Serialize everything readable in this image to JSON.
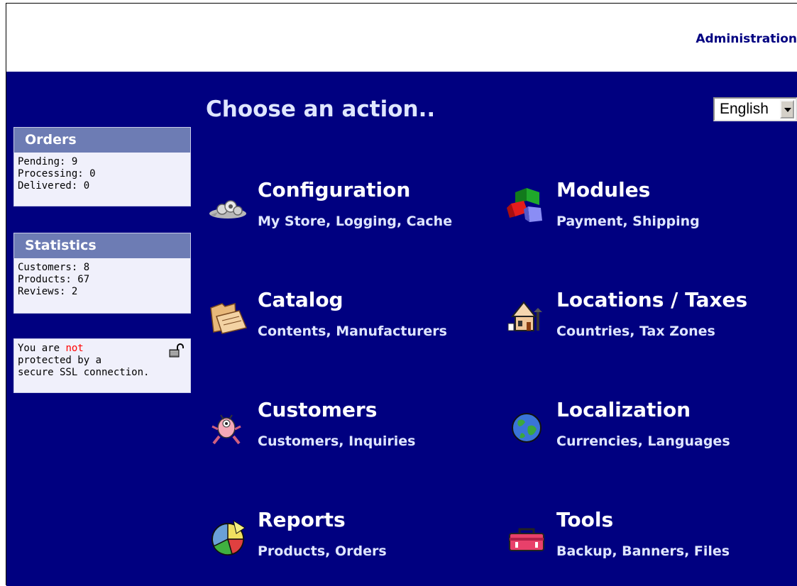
{
  "header": {
    "admin_link": "Administration"
  },
  "sidebar": {
    "orders": {
      "title": "Orders",
      "lines": [
        "Pending: 9",
        "Processing: 0",
        "Delivered: 0"
      ]
    },
    "statistics": {
      "title": "Statistics",
      "lines": [
        "Customers: 8",
        "Products: 67",
        "Reviews: 2"
      ]
    },
    "ssl": {
      "prefix": "You are ",
      "highlight": "not",
      "line2": "protected by a",
      "line3": "secure SSL connection.",
      "icon": "unlocked-padlock-icon",
      "highlight_color": "#ff0000"
    }
  },
  "main": {
    "title": "Choose an action..",
    "language": "English",
    "actions": [
      {
        "title": "Configuration",
        "subtitle": "My Store, Logging, Cache",
        "icon": "configuration-icon"
      },
      {
        "title": "Modules",
        "subtitle": "Payment, Shipping",
        "icon": "modules-cubes-icon"
      },
      {
        "title": "Catalog",
        "subtitle": "Contents, Manufacturers",
        "icon": "catalog-folder-icon"
      },
      {
        "title": "Locations / Taxes",
        "subtitle": "Countries, Tax Zones",
        "icon": "house-icon"
      },
      {
        "title": "Customers",
        "subtitle": "Customers, Inquiries",
        "icon": "customer-creature-icon"
      },
      {
        "title": "Localization",
        "subtitle": "Currencies, Languages",
        "icon": "globe-icon"
      },
      {
        "title": "Reports",
        "subtitle": "Products, Orders",
        "icon": "pie-chart-icon"
      },
      {
        "title": "Tools",
        "subtitle": "Backup, Banners, Files",
        "icon": "toolbox-icon"
      }
    ]
  },
  "colors": {
    "background": "#000080",
    "box_header": "#6d7cb4",
    "box_body": "#f0f0fb",
    "link": "#000080"
  }
}
